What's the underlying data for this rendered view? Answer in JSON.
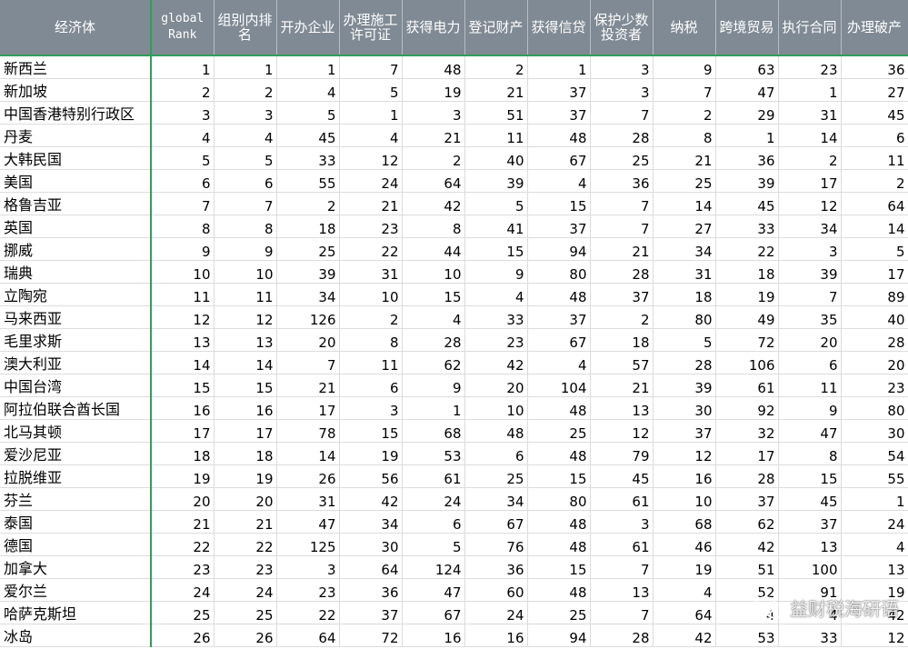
{
  "headers": {
    "economy": "经济体",
    "global_rank": "global Rank",
    "group_rank": "组别内排名",
    "starting_business": "开办企业",
    "construction_permits": "办理施工许可证",
    "getting_electricity": "获得电力",
    "registering_property": "登记财产",
    "getting_credit": "获得信贷",
    "protecting_investors": "保护少数投资者",
    "paying_taxes": "纳税",
    "trading_across_borders": "跨境贸易",
    "enforcing_contracts": "执行合同",
    "resolving_insolvency": "办理破产"
  },
  "rows": [
    [
      "新西兰",
      "1",
      "1",
      "1",
      "7",
      "48",
      "2",
      "1",
      "3",
      "9",
      "63",
      "23",
      "36"
    ],
    [
      "新加坡",
      "2",
      "2",
      "4",
      "5",
      "19",
      "21",
      "37",
      "3",
      "7",
      "47",
      "1",
      "27"
    ],
    [
      "中国香港特别行政区",
      "3",
      "3",
      "5",
      "1",
      "3",
      "51",
      "37",
      "7",
      "2",
      "29",
      "31",
      "45"
    ],
    [
      "丹麦",
      "4",
      "4",
      "45",
      "4",
      "21",
      "11",
      "48",
      "28",
      "8",
      "1",
      "14",
      "6"
    ],
    [
      "大韩民国",
      "5",
      "5",
      "33",
      "12",
      "2",
      "40",
      "67",
      "25",
      "21",
      "36",
      "2",
      "11"
    ],
    [
      "美国",
      "6",
      "6",
      "55",
      "24",
      "64",
      "39",
      "4",
      "36",
      "25",
      "39",
      "17",
      "2"
    ],
    [
      "格鲁吉亚",
      "7",
      "7",
      "2",
      "21",
      "42",
      "5",
      "15",
      "7",
      "14",
      "45",
      "12",
      "64"
    ],
    [
      "英国",
      "8",
      "8",
      "18",
      "23",
      "8",
      "41",
      "37",
      "7",
      "27",
      "33",
      "34",
      "14"
    ],
    [
      "挪威",
      "9",
      "9",
      "25",
      "22",
      "44",
      "15",
      "94",
      "21",
      "34",
      "22",
      "3",
      "5"
    ],
    [
      "瑞典",
      "10",
      "10",
      "39",
      "31",
      "10",
      "9",
      "80",
      "28",
      "31",
      "18",
      "39",
      "17"
    ],
    [
      "立陶宛",
      "11",
      "11",
      "34",
      "10",
      "15",
      "4",
      "48",
      "37",
      "18",
      "19",
      "7",
      "89"
    ],
    [
      "马来西亚",
      "12",
      "12",
      "126",
      "2",
      "4",
      "33",
      "37",
      "2",
      "80",
      "49",
      "35",
      "40"
    ],
    [
      "毛里求斯",
      "13",
      "13",
      "20",
      "8",
      "28",
      "23",
      "67",
      "18",
      "5",
      "72",
      "20",
      "28"
    ],
    [
      "澳大利亚",
      "14",
      "14",
      "7",
      "11",
      "62",
      "42",
      "4",
      "57",
      "28",
      "106",
      "6",
      "20"
    ],
    [
      "中国台湾",
      "15",
      "15",
      "21",
      "6",
      "9",
      "20",
      "104",
      "21",
      "39",
      "61",
      "11",
      "23"
    ],
    [
      "阿拉伯联合酋长国",
      "16",
      "16",
      "17",
      "3",
      "1",
      "10",
      "48",
      "13",
      "30",
      "92",
      "9",
      "80"
    ],
    [
      "北马其顿",
      "17",
      "17",
      "78",
      "15",
      "68",
      "48",
      "25",
      "12",
      "37",
      "32",
      "47",
      "30"
    ],
    [
      "爱沙尼亚",
      "18",
      "18",
      "14",
      "19",
      "53",
      "6",
      "48",
      "79",
      "12",
      "17",
      "8",
      "54"
    ],
    [
      "拉脱维亚",
      "19",
      "19",
      "26",
      "56",
      "61",
      "25",
      "15",
      "45",
      "16",
      "28",
      "15",
      "55"
    ],
    [
      "芬兰",
      "20",
      "20",
      "31",
      "42",
      "24",
      "34",
      "80",
      "61",
      "10",
      "37",
      "45",
      "1"
    ],
    [
      "泰国",
      "21",
      "21",
      "47",
      "34",
      "6",
      "67",
      "48",
      "3",
      "68",
      "62",
      "37",
      "24"
    ],
    [
      "德国",
      "22",
      "22",
      "125",
      "30",
      "5",
      "76",
      "48",
      "61",
      "46",
      "42",
      "13",
      "4"
    ],
    [
      "加拿大",
      "23",
      "23",
      "3",
      "64",
      "124",
      "36",
      "15",
      "7",
      "19",
      "51",
      "100",
      "13"
    ],
    [
      "爱尔兰",
      "24",
      "24",
      "23",
      "36",
      "47",
      "60",
      "48",
      "13",
      "4",
      "52",
      "91",
      "19"
    ],
    [
      "哈萨克斯坦",
      "25",
      "25",
      "22",
      "37",
      "67",
      "24",
      "25",
      "7",
      "64",
      "4",
      "4",
      "42"
    ],
    [
      "冰岛",
      "26",
      "26",
      "64",
      "72",
      "16",
      "16",
      "94",
      "28",
      "42",
      "53",
      "33",
      "12"
    ]
  ],
  "watermark": {
    "text": "益财税海研语",
    "icon": "wechat-icon"
  },
  "colors": {
    "header_bg": "#808a94",
    "header_text": "#ffffff",
    "frozen_pane_line": "#2e9e5b",
    "grid": "#dcdcdc"
  }
}
